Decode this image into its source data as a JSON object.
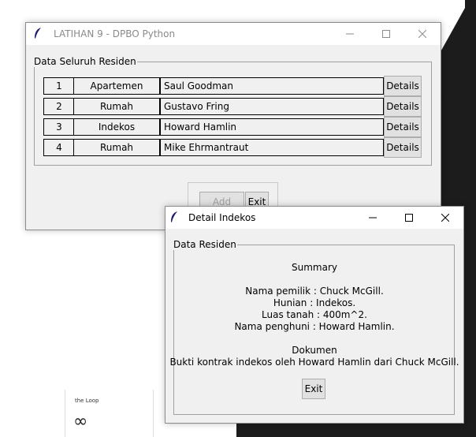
{
  "main_window": {
    "title": "LATIHAN 9 - DPBO Python",
    "group_label": "Data Seluruh Residen",
    "rows": [
      {
        "no": "1",
        "type": "Apartemen",
        "name": "Saul Goodman",
        "details": "Details"
      },
      {
        "no": "2",
        "type": "Rumah",
        "name": "Gustavo Fring",
        "details": "Details"
      },
      {
        "no": "3",
        "type": "Indekos",
        "name": "Howard Hamlin",
        "details": "Details"
      },
      {
        "no": "4",
        "type": "Rumah",
        "name": "Mike Ehrmantraut",
        "details": "Details"
      }
    ],
    "add_button": "Add Data",
    "exit_button": "Exit"
  },
  "detail_window": {
    "title": "Detail Indekos",
    "group_label": "Data Residen",
    "summary_heading": "Summary",
    "owner": "Nama pemilik : Chuck McGill.",
    "dwelling": "Hunian : Indekos.",
    "area": "Luas tanah : 400m^2.",
    "resident": "Nama penghuni : Howard Hamlin.",
    "doc_heading": "Dokumen",
    "doc_text": "Bukti kontrak indekos oleh Howard Hamlin dari Chuck McGill.",
    "exit_button": "Exit"
  },
  "background": {
    "card_title": "the Loop",
    "card_glyph": "∞"
  },
  "colors": {
    "desktop_dark": "#1c1c1c",
    "window_bg": "#f0f0f0",
    "titlebar_bg": "#ffffff"
  },
  "icons": {
    "app_icon": "feather-icon",
    "minimize": "minimize-icon",
    "maximize": "maximize-icon",
    "close": "close-icon"
  }
}
